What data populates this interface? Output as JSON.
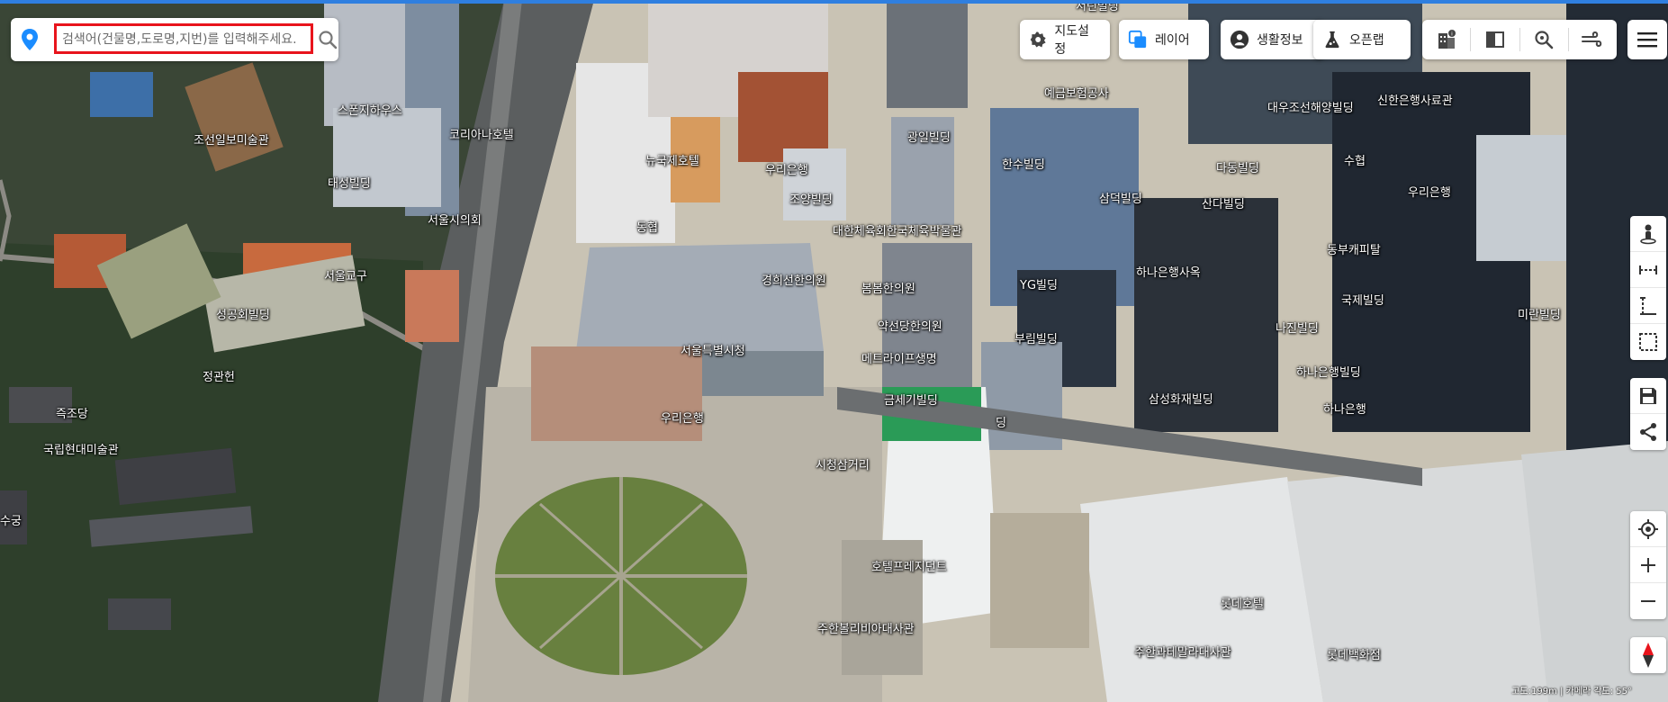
{
  "search": {
    "placeholder": "검색어(건물명,도로명,지번)를 입력해주세요."
  },
  "toolbar": {
    "map_settings_label": "지도설정",
    "layer_label": "레이어",
    "life_info_label": "생활정보",
    "open_app_label": "오픈랩"
  },
  "status": {
    "scale_text": "고도:199m | 카메라 각도: 55°"
  },
  "colors": {
    "accent": "#2f7fe0",
    "search_highlight": "#e8141c",
    "pin": "#1a8cff"
  },
  "labels": [
    {
      "text": "서린빌딩"
    },
    {
      "text": "스폰지하우스"
    },
    {
      "text": "조선일보미술관"
    },
    {
      "text": "코리아나호텔"
    },
    {
      "text": "태성빌딩"
    },
    {
      "text": "서울시의회"
    },
    {
      "text": "서울교구"
    },
    {
      "text": "성공회빌딩"
    },
    {
      "text": "정관헌"
    },
    {
      "text": "즉조당"
    },
    {
      "text": "국립현대미술관"
    },
    {
      "text": "수궁"
    },
    {
      "text": "뉴국제호텔"
    },
    {
      "text": "동협"
    },
    {
      "text": "우리은행"
    },
    {
      "text": "조양빌딩"
    },
    {
      "text": "광일빌딩"
    },
    {
      "text": "대한체육회한국체육박물관"
    },
    {
      "text": "경희선한의원"
    },
    {
      "text": "봄봄한의원"
    },
    {
      "text": "약선당한의원"
    },
    {
      "text": "서울특별시청"
    },
    {
      "text": "메트라이프생명"
    },
    {
      "text": "금세기빌딩"
    },
    {
      "text": "우리은행"
    },
    {
      "text": "시청삼거리"
    },
    {
      "text": "호텔프레지던트"
    },
    {
      "text": "주한볼리비아대사관"
    },
    {
      "text": "예금보험공사"
    },
    {
      "text": "한수빌딩"
    },
    {
      "text": "삼덕빌딩"
    },
    {
      "text": "YG빌딩"
    },
    {
      "text": "부림빌딩"
    },
    {
      "text": "대우조선해양빌딩"
    },
    {
      "text": "다동빌딩"
    },
    {
      "text": "산다빌딩"
    },
    {
      "text": "하나은행사옥"
    },
    {
      "text": "신한은행사료관"
    },
    {
      "text": "수협"
    },
    {
      "text": "우리은행"
    },
    {
      "text": "동부캐피탈"
    },
    {
      "text": "국제빌딩"
    },
    {
      "text": "나진빌딩"
    },
    {
      "text": "삼성화재빌딩"
    },
    {
      "text": "하나은행빌딩"
    },
    {
      "text": "하나은행"
    },
    {
      "text": "미란빌딩"
    },
    {
      "text": "롯데호텔"
    },
    {
      "text": "주한과테말라대사관"
    },
    {
      "text": "롯데백화점"
    },
    {
      "text": "딩"
    }
  ]
}
